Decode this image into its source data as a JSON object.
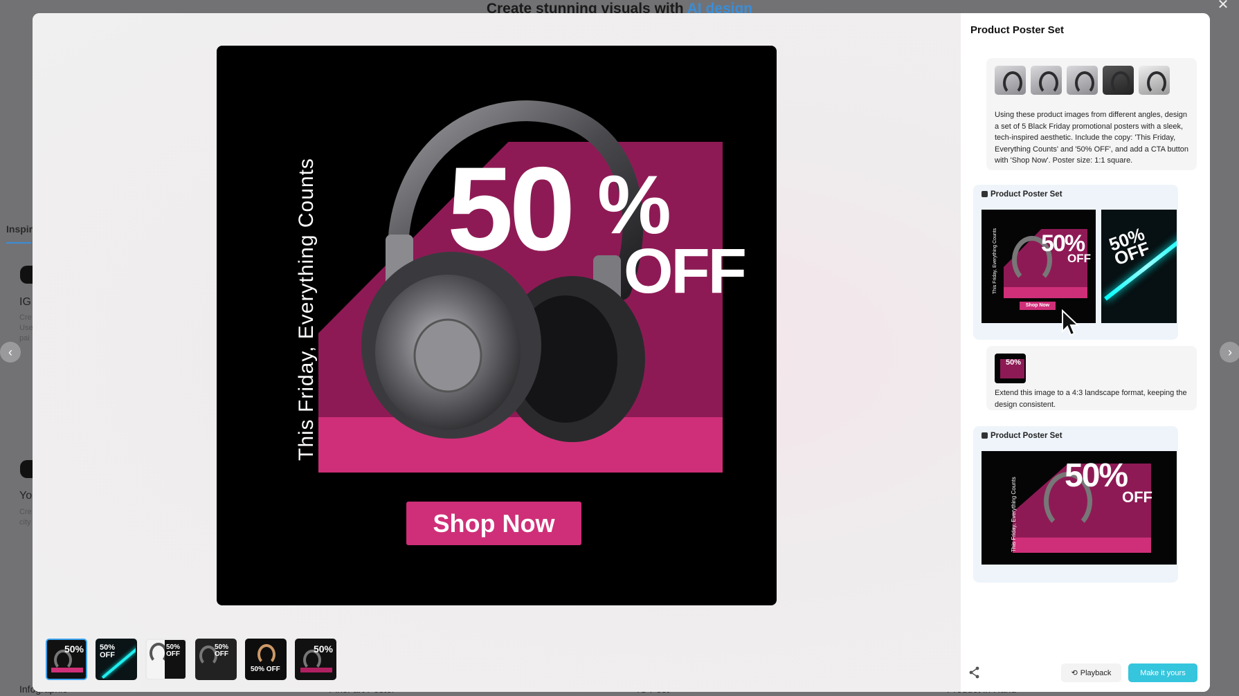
{
  "background": {
    "title_prefix": "Create stunning visuals with ",
    "title_accent": "AI design",
    "side_label": "Inspira",
    "cards": [
      {
        "title": "IG",
        "sub": "Cre Use pai"
      },
      {
        "title": "Yo",
        "sub": "Cre city"
      }
    ],
    "bottom_labels": [
      "Infographic",
      "Pixel-art Poster",
      "IG Post",
      "Product in Hand"
    ]
  },
  "poster": {
    "vertical_text": "This Friday, Everything Counts",
    "big_number": "50",
    "percent": "%",
    "off": "OFF",
    "cta": "Shop Now"
  },
  "thumbnails": [
    {
      "label": "50%",
      "active": true
    },
    {
      "label": "50% OFF",
      "active": false
    },
    {
      "label": "50% OFF",
      "active": false
    },
    {
      "label": "50% OFF",
      "active": false
    },
    {
      "label": "50% OFF",
      "active": false
    },
    {
      "label": "50%",
      "active": false
    }
  ],
  "panel": {
    "title": "Product Poster Set",
    "prompt_text": "Using these product images from different angles, design a set of 5 Black Friday promotional posters with a sleek, tech-inspired aesthetic. Include the copy: 'This Friday, Everything Counts' and '50% OFF', and add a CTA button with 'Shop Now'. Poster size: 1:1 square.",
    "result1_label": "Product Poster Set",
    "result1_img1_vertical": "This Friday, Everything Counts",
    "result1_img1_pct": "50%",
    "result1_img1_off": "OFF",
    "result1_img1_btn": "Shop Now",
    "result1_img2_text": "50% OFF",
    "followup_text": "Extend this image to a 4:3 landscape format, keeping the design consistent.",
    "followup_thumb": "50%",
    "result2_label": "Product Poster Set",
    "result2_vertical": "This Friday, Everything Counts",
    "result2_pct": "50%",
    "result2_off": "OFF",
    "playback_label": "Playback",
    "make_label": "Make it yours"
  },
  "colors": {
    "magenta_dark": "#8e1a55",
    "magenta": "#cf2f78",
    "accent_blue": "#3a8ed8",
    "cta_cyan": "#35c5dd"
  }
}
